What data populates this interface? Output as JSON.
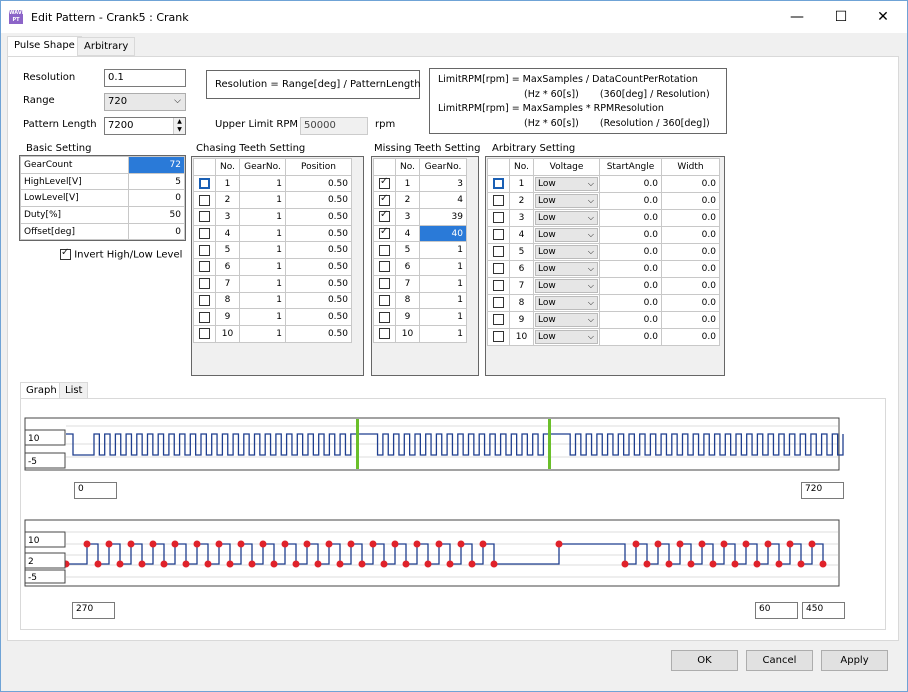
{
  "window": {
    "title": "Edit Pattern - Crank5 : Crank",
    "icon": "app-icon",
    "controls": [
      "minimize-icon",
      "maximize-icon",
      "close-icon"
    ]
  },
  "tabs": [
    "Pulse Shape",
    "Arbitrary"
  ],
  "form": {
    "resolution_label": "Resolution",
    "resolution_value": "0.1",
    "range_label": "Range",
    "range_value": "720",
    "pattern_length_label": "Pattern Length",
    "pattern_length_value": "7200",
    "upper_limit_label": "Upper Limit RPM",
    "upper_limit_value": "50000",
    "upper_limit_unit": "rpm"
  },
  "formula1": "Resolution = Range[deg] / PatternLength",
  "formula2": {
    "line1": "LimitRPM[rpm] = MaxSamples / DataCountPerRotation",
    "line2": "(Hz * 60[s])       (360[deg] / Resolution)",
    "line3": "LimitRPM[rpm] = MaxSamples * RPMResolution",
    "line4": "(Hz * 60[s])       (Resolution / 360[deg])"
  },
  "basic": {
    "title": "Basic Setting",
    "rows": [
      [
        "GearCount",
        "72"
      ],
      [
        "HighLevel[V]",
        "5"
      ],
      [
        "LowLevel[V]",
        "0"
      ],
      [
        "Duty[%]",
        "50"
      ],
      [
        "Offset[deg]",
        "0"
      ]
    ],
    "invert_label": "Invert High/Low Level",
    "invert_checked": true
  },
  "chasing": {
    "title": "Chasing Teeth Setting",
    "headers": [
      "",
      "No.",
      "GearNo.",
      "Position"
    ],
    "rows": [
      [
        "1",
        "1",
        "0.50"
      ],
      [
        "2",
        "1",
        "0.50"
      ],
      [
        "3",
        "1",
        "0.50"
      ],
      [
        "4",
        "1",
        "0.50"
      ],
      [
        "5",
        "1",
        "0.50"
      ],
      [
        "6",
        "1",
        "0.50"
      ],
      [
        "7",
        "1",
        "0.50"
      ],
      [
        "8",
        "1",
        "0.50"
      ],
      [
        "9",
        "1",
        "0.50"
      ],
      [
        "10",
        "1",
        "0.50"
      ]
    ]
  },
  "missing": {
    "title": "Missing Teeth Setting",
    "headers": [
      "",
      "No.",
      "GearNo."
    ],
    "rows": [
      [
        "1",
        "3",
        true
      ],
      [
        "2",
        "4",
        true
      ],
      [
        "3",
        "39",
        true
      ],
      [
        "4",
        "40",
        true
      ],
      [
        "5",
        "1",
        false
      ],
      [
        "6",
        "1",
        false
      ],
      [
        "7",
        "1",
        false
      ],
      [
        "8",
        "1",
        false
      ],
      [
        "9",
        "1",
        false
      ],
      [
        "10",
        "1",
        false
      ]
    ]
  },
  "arbitrary": {
    "title": "Arbitrary Setting",
    "headers": [
      "",
      "No.",
      "Voltage",
      "StartAngle",
      "Width"
    ],
    "rows": [
      [
        "1",
        "Low",
        "0.0",
        "0.0"
      ],
      [
        "2",
        "Low",
        "0.0",
        "0.0"
      ],
      [
        "3",
        "Low",
        "0.0",
        "0.0"
      ],
      [
        "4",
        "Low",
        "0.0",
        "0.0"
      ],
      [
        "5",
        "Low",
        "0.0",
        "0.0"
      ],
      [
        "6",
        "Low",
        "0.0",
        "0.0"
      ],
      [
        "7",
        "Low",
        "0.0",
        "0.0"
      ],
      [
        "8",
        "Low",
        "0.0",
        "0.0"
      ],
      [
        "9",
        "Low",
        "0.0",
        "0.0"
      ],
      [
        "10",
        "Low",
        "0.0",
        "0.0"
      ]
    ]
  },
  "graph_tabs": [
    "Graph",
    "List"
  ],
  "graph1": {
    "y_top": "10",
    "y_bottom": "-5",
    "x_min": "0",
    "x_max": "720"
  },
  "graph2": {
    "y_top": "10",
    "y_mid": "2",
    "y_bottom": "-5",
    "x_min": "270",
    "x_max_a": "60",
    "x_max_b": "450"
  },
  "buttons": {
    "ok": "OK",
    "cancel": "Cancel",
    "apply": "Apply"
  },
  "colors": {
    "selection": "#2a7ad8",
    "waveform": "#1f3f8f",
    "marker": "#6abf2a",
    "point": "#e0222a"
  }
}
